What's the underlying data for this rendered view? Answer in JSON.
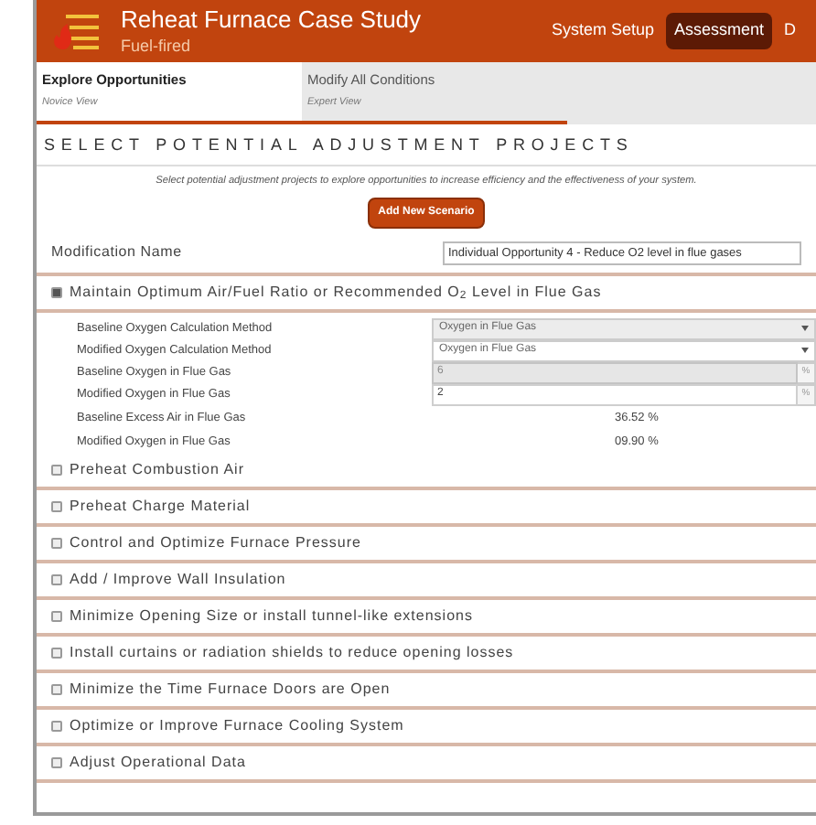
{
  "header": {
    "title": "Reheat Furnace Case Study",
    "subtitle": "Fuel-fired",
    "nav": [
      {
        "label": "System Setup",
        "selected": false
      },
      {
        "label": "Assessment",
        "selected": true
      },
      {
        "label": "D",
        "selected": false
      }
    ]
  },
  "tabs": [
    {
      "label": "Explore Opportunities",
      "sublabel": "Novice View",
      "selected": true
    },
    {
      "label": "Modify All Conditions",
      "sublabel": "Expert View",
      "selected": false
    }
  ],
  "section_title": "SELECT POTENTIAL ADJUSTMENT PROJECTS",
  "description": "Select potential adjustment projects to explore opportunities to increase efficiency and the effectiveness of your system.",
  "add_button": "Add New Scenario",
  "modification_name": {
    "label": "Modification Name",
    "value": "Individual Opportunity 4 - Reduce O2 level in flue gases"
  },
  "opportunities": [
    {
      "label": "Maintain Optimum Air/Fuel Ratio or Recommended O$_{2}$ Level in Flue Gas",
      "checked": true,
      "fields": [
        {
          "kind": "select",
          "label": "Baseline Oxygen Calculation Method",
          "value": "Oxygen in Flue Gas",
          "disabled": true
        },
        {
          "kind": "select",
          "label": "Modified Oxygen Calculation Method",
          "value": "Oxygen in Flue Gas",
          "disabled": false
        },
        {
          "kind": "input",
          "label": "Baseline Oxygen in Flue Gas",
          "value": "6",
          "unit": "%",
          "disabled": true
        },
        {
          "kind": "input",
          "label": "Modified Oxygen in Flue Gas",
          "value": "2",
          "unit": "%",
          "disabled": false
        },
        {
          "kind": "reading",
          "label": "Baseline Excess Air in Flue Gas",
          "value": "36.52 %"
        },
        {
          "kind": "reading",
          "label": "Modified Oxygen in Flue Gas",
          "value": "09.90 %"
        }
      ]
    },
    {
      "label": "Preheat Combustion Air",
      "checked": false
    },
    {
      "label": "Preheat Charge Material",
      "checked": false
    },
    {
      "label": "Control and Optimize Furnace Pressure",
      "checked": false
    },
    {
      "label": "Add / Improve Wall Insulation",
      "checked": false
    },
    {
      "label": "Minimize Opening Size or install tunnel-like extensions",
      "checked": false
    },
    {
      "label": "Install curtains or radiation shields to reduce opening losses",
      "checked": false
    },
    {
      "label": "Minimize the Time Furnace Doors are Open",
      "checked": false
    },
    {
      "label": "Optimize or Improve Furnace Cooling System",
      "checked": false
    },
    {
      "label": "Adjust Operational Data",
      "checked": false
    }
  ]
}
